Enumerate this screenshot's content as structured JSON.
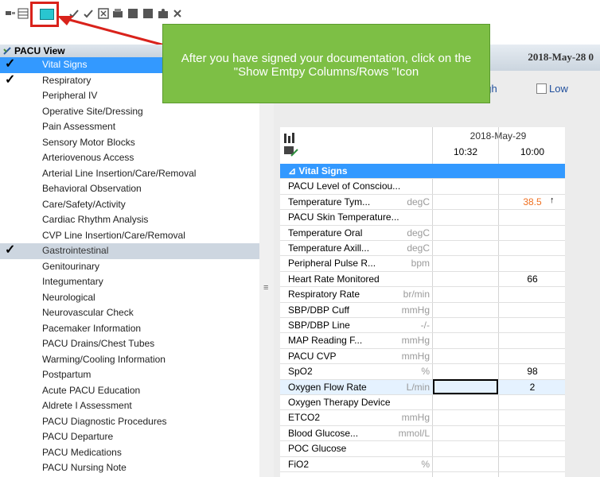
{
  "toolbar": {
    "icons": [
      "grid-view-icon",
      "table-icon",
      "show-empty-columns-rows-icon",
      "sign-check-icon",
      "checkmark-icon",
      "unchart-icon",
      "print-icon",
      "save-icon",
      "calculator-icon",
      "patient-icon",
      "cancel-icon"
    ]
  },
  "callout": {
    "text": "After you  have signed your documentation, click on the \"Show Emtpy Columns/Rows \"Icon"
  },
  "sidebar": {
    "title": "PACU View",
    "items": [
      {
        "label": "Vital Signs",
        "checked": true,
        "state": "selected"
      },
      {
        "label": "Respiratory",
        "checked": true,
        "state": ""
      },
      {
        "label": "Peripheral IV",
        "checked": false,
        "state": ""
      },
      {
        "label": "Operative Site/Dressing",
        "checked": false,
        "state": ""
      },
      {
        "label": "Pain Assessment",
        "checked": false,
        "state": ""
      },
      {
        "label": "Sensory Motor Blocks",
        "checked": false,
        "state": ""
      },
      {
        "label": "Arteriovenous Access",
        "checked": false,
        "state": ""
      },
      {
        "label": "Arterial Line Insertion/Care/Removal",
        "checked": false,
        "state": ""
      },
      {
        "label": "Behavioral Observation",
        "checked": false,
        "state": ""
      },
      {
        "label": "Care/Safety/Activity",
        "checked": false,
        "state": ""
      },
      {
        "label": "Cardiac Rhythm Analysis",
        "checked": false,
        "state": ""
      },
      {
        "label": "CVP Line Insertion/Care/Removal",
        "checked": false,
        "state": ""
      },
      {
        "label": "Gastrointestinal",
        "checked": true,
        "state": "grey"
      },
      {
        "label": "Genitourinary",
        "checked": false,
        "state": ""
      },
      {
        "label": "Integumentary",
        "checked": false,
        "state": ""
      },
      {
        "label": "Neurological",
        "checked": false,
        "state": ""
      },
      {
        "label": "Neurovascular Check",
        "checked": false,
        "state": ""
      },
      {
        "label": "Pacemaker Information",
        "checked": false,
        "state": ""
      },
      {
        "label": "PACU Drains/Chest Tubes",
        "checked": false,
        "state": ""
      },
      {
        "label": "Warming/Cooling Information",
        "checked": false,
        "state": ""
      },
      {
        "label": "Postpartum",
        "checked": false,
        "state": ""
      },
      {
        "label": "Acute PACU Education",
        "checked": false,
        "state": ""
      },
      {
        "label": "Aldrete I Assessment",
        "checked": false,
        "state": ""
      },
      {
        "label": "PACU Diagnostic Procedures",
        "checked": false,
        "state": ""
      },
      {
        "label": "PACU Departure",
        "checked": false,
        "state": ""
      },
      {
        "label": "PACU Medications",
        "checked": false,
        "state": ""
      },
      {
        "label": "PACU Nursing Note",
        "checked": false,
        "state": ""
      }
    ]
  },
  "header": {
    "date_banner": "2018-May-28 0",
    "high_label": "High",
    "low_label": "Low"
  },
  "grid": {
    "date": "2018-May-29",
    "times": [
      "10:32",
      "10:00"
    ],
    "section_title": "Vital Signs",
    "rows": [
      {
        "label": "PACU Level of Consciou...",
        "unit": "",
        "v1": "",
        "v2": "",
        "flag": ""
      },
      {
        "label": "Temperature Tym...",
        "unit": "degC",
        "v1": "",
        "v2": "38.5",
        "flag": "↑"
      },
      {
        "label": "PACU Skin Temperature...",
        "unit": "",
        "v1": "",
        "v2": "",
        "flag": ""
      },
      {
        "label": "Temperature Oral",
        "unit": "degC",
        "v1": "",
        "v2": "",
        "flag": ""
      },
      {
        "label": "Temperature Axill...",
        "unit": "degC",
        "v1": "",
        "v2": "",
        "flag": ""
      },
      {
        "label": "Peripheral Pulse R...",
        "unit": "bpm",
        "v1": "",
        "v2": "",
        "flag": ""
      },
      {
        "label": "Heart Rate Monitored",
        "unit": "",
        "v1": "",
        "v2": "66",
        "flag": ""
      },
      {
        "label": "Respiratory Rate",
        "unit": "br/min",
        "v1": "",
        "v2": "",
        "flag": ""
      },
      {
        "label": "SBP/DBP Cuff",
        "unit": "mmHg",
        "v1": "",
        "v2": "",
        "flag": ""
      },
      {
        "label": "SBP/DBP Line",
        "unit": "-/-",
        "v1": "",
        "v2": "",
        "flag": ""
      },
      {
        "label": "MAP Reading F...",
        "unit": "mmHg",
        "v1": "",
        "v2": "",
        "flag": ""
      },
      {
        "label": "PACU CVP",
        "unit": "mmHg",
        "v1": "",
        "v2": "",
        "flag": ""
      },
      {
        "label": "SpO2",
        "unit": "%",
        "v1": "",
        "v2": "98",
        "flag": ""
      },
      {
        "label": "Oxygen Flow Rate",
        "unit": "L/min",
        "v1": "",
        "v2": "2",
        "flag": ""
      },
      {
        "label": "Oxygen Therapy Device",
        "unit": "",
        "v1": "",
        "v2": "",
        "flag": ""
      },
      {
        "label": "ETCO2",
        "unit": "mmHg",
        "v1": "",
        "v2": "",
        "flag": ""
      },
      {
        "label": "Blood Glucose...",
        "unit": "mmol/L",
        "v1": "",
        "v2": "",
        "flag": ""
      },
      {
        "label": "POC Glucose",
        "unit": "",
        "v1": "",
        "v2": "",
        "flag": ""
      },
      {
        "label": "FiO2",
        "unit": "%",
        "v1": "",
        "v2": "",
        "flag": ""
      }
    ]
  },
  "colors": {
    "selected_row": "#3399ff",
    "callout_green": "#7dbf45",
    "highlight_red": "#d9221b",
    "abnormal_value": "#f07020"
  }
}
